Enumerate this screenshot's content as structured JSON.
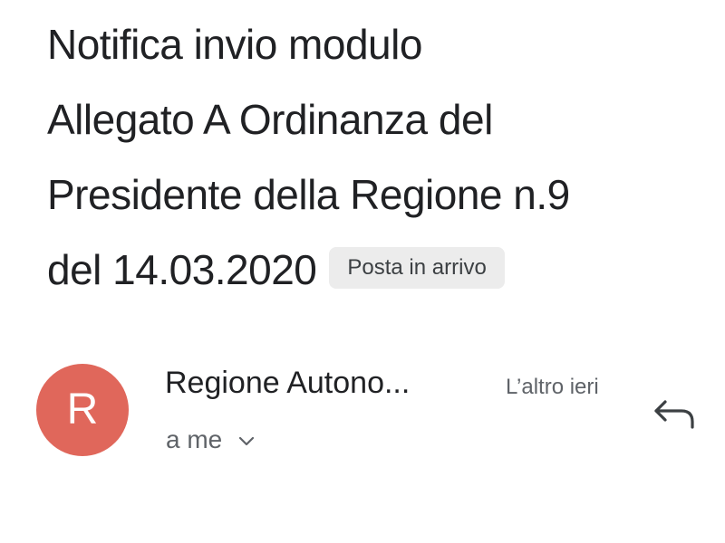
{
  "email": {
    "subject_lines": [
      "Notifica invio modulo",
      "Allegato A Ordinanza del",
      "Presidente della Regione n.9",
      "del 14.03.2020"
    ],
    "label": "Posta in arrivo",
    "sender": {
      "avatar_letter": "R",
      "avatar_color": "#e0675b",
      "name": "Regione Autono...",
      "timestamp": "L’altro ieri",
      "recipient": "a me"
    }
  },
  "icons": {
    "reply": "reply-icon",
    "expand": "chevron-down-icon"
  }
}
